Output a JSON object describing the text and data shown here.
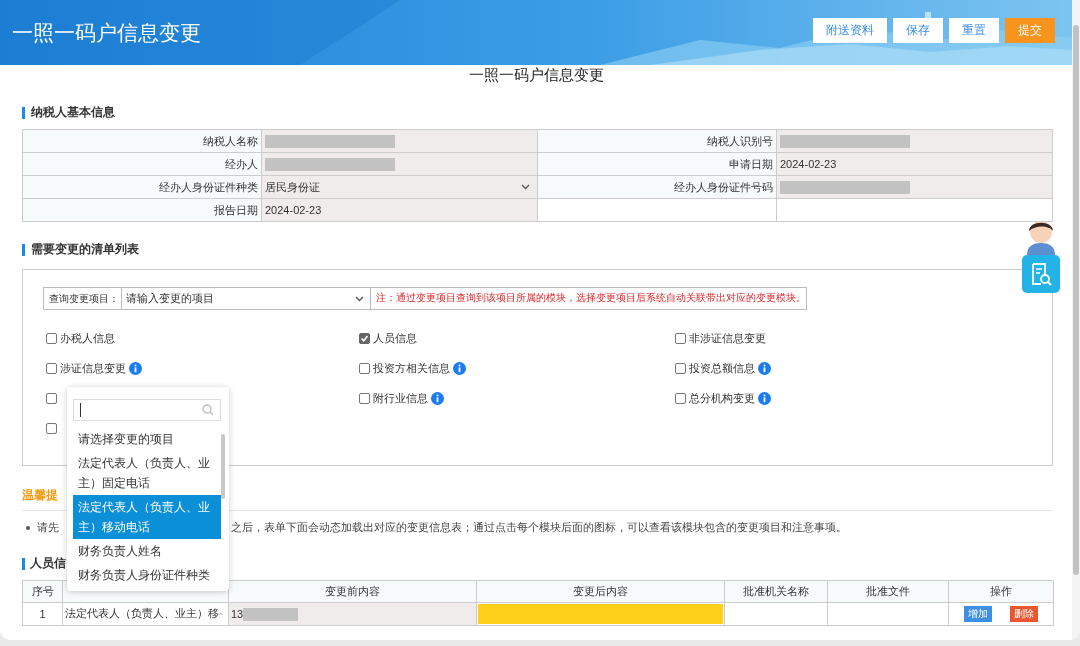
{
  "header": {
    "title": "一照一码户信息变更",
    "buttons": [
      {
        "label": "附送资料",
        "kind": "plain"
      },
      {
        "label": "保存",
        "kind": "plain"
      },
      {
        "label": "重置",
        "kind": "plain"
      },
      {
        "label": "提交",
        "kind": "primary"
      }
    ]
  },
  "page_title": "一照一码户信息变更",
  "basic_info": {
    "title": "纳税人基本信息",
    "fields": [
      {
        "label": "纳税人名称",
        "kind": "text",
        "redacted": true
      },
      {
        "label": "纳税人识别号",
        "kind": "text",
        "redacted": true
      },
      {
        "label": "经办人",
        "kind": "text",
        "redacted": true
      },
      {
        "label": "申请日期",
        "kind": "text",
        "value": "2024-02-23"
      },
      {
        "label": "经办人身份证件种类",
        "kind": "select",
        "value": "居民身份证"
      },
      {
        "label": "经办人身份证件号码",
        "kind": "text",
        "redacted": true
      },
      {
        "label": "报告日期",
        "kind": "text",
        "value": "2024-02-23"
      }
    ]
  },
  "change_list": {
    "title": "需要变更的清单列表",
    "query": {
      "label": "查询变更项目：",
      "placeholder": "请输入变更的项目"
    },
    "note": "注：通过变更项目查询到该项目所属的模块，选择变更项目后系统自动关联带出对应的变更模块。",
    "items": [
      {
        "label": "办税人信息",
        "checked": false,
        "info": false
      },
      {
        "label": "人员信息",
        "checked": true,
        "info": false
      },
      {
        "label": "非涉证信息变更",
        "checked": false,
        "info": false
      },
      {
        "label": "涉证信息变更",
        "checked": false,
        "info": true
      },
      {
        "label": "投资方相关信息",
        "checked": false,
        "info": true
      },
      {
        "label": "投资总额信息",
        "checked": false,
        "info": true
      },
      {
        "checked": false,
        "info": false
      },
      {
        "label": "附行业信息",
        "checked": false,
        "info": true
      },
      {
        "label": "总分机构变更",
        "checked": false,
        "info": true
      },
      {
        "checked": false,
        "info": false
      }
    ]
  },
  "tips": {
    "title": "温馨提",
    "text_parts": [
      "请先",
      "之后，表单下面会动态加载出对应的变更信息表；通过点击每个模块后面的图标，可以查看该模块包含的变更项目和注意事项。"
    ]
  },
  "personnel": {
    "title": "人员信",
    "columns": [
      {
        "label": "序号"
      },
      {},
      {
        "label": "变更前内容"
      },
      {
        "label": "变更后内容"
      },
      {
        "label": "批准机关名称"
      },
      {
        "label": "批准文件"
      },
      {
        "label": "操作"
      }
    ],
    "rows": [
      {
        "index": "1",
        "item": "法定代表人（负责人、业主）移",
        "before": {
          "value": "13",
          "redacted": true
        },
        "after": {
          "highlighted": true
        },
        "actions": [
          {
            "label": "增加",
            "kind": "add"
          },
          {
            "label": "删除",
            "kind": "delete"
          }
        ]
      }
    ]
  },
  "dropdown": {
    "options": [
      {
        "label": "请选择变更的项目",
        "selected": false
      },
      {
        "label": "法定代表人（负责人、业主）固定电话",
        "selected": false
      },
      {
        "label": "法定代表人（负责人、业主）移动电话",
        "selected": true
      },
      {
        "label": "财务负责人姓名",
        "selected": false
      },
      {
        "label": "财务负责人身份证件种类",
        "selected": false
      }
    ]
  }
}
